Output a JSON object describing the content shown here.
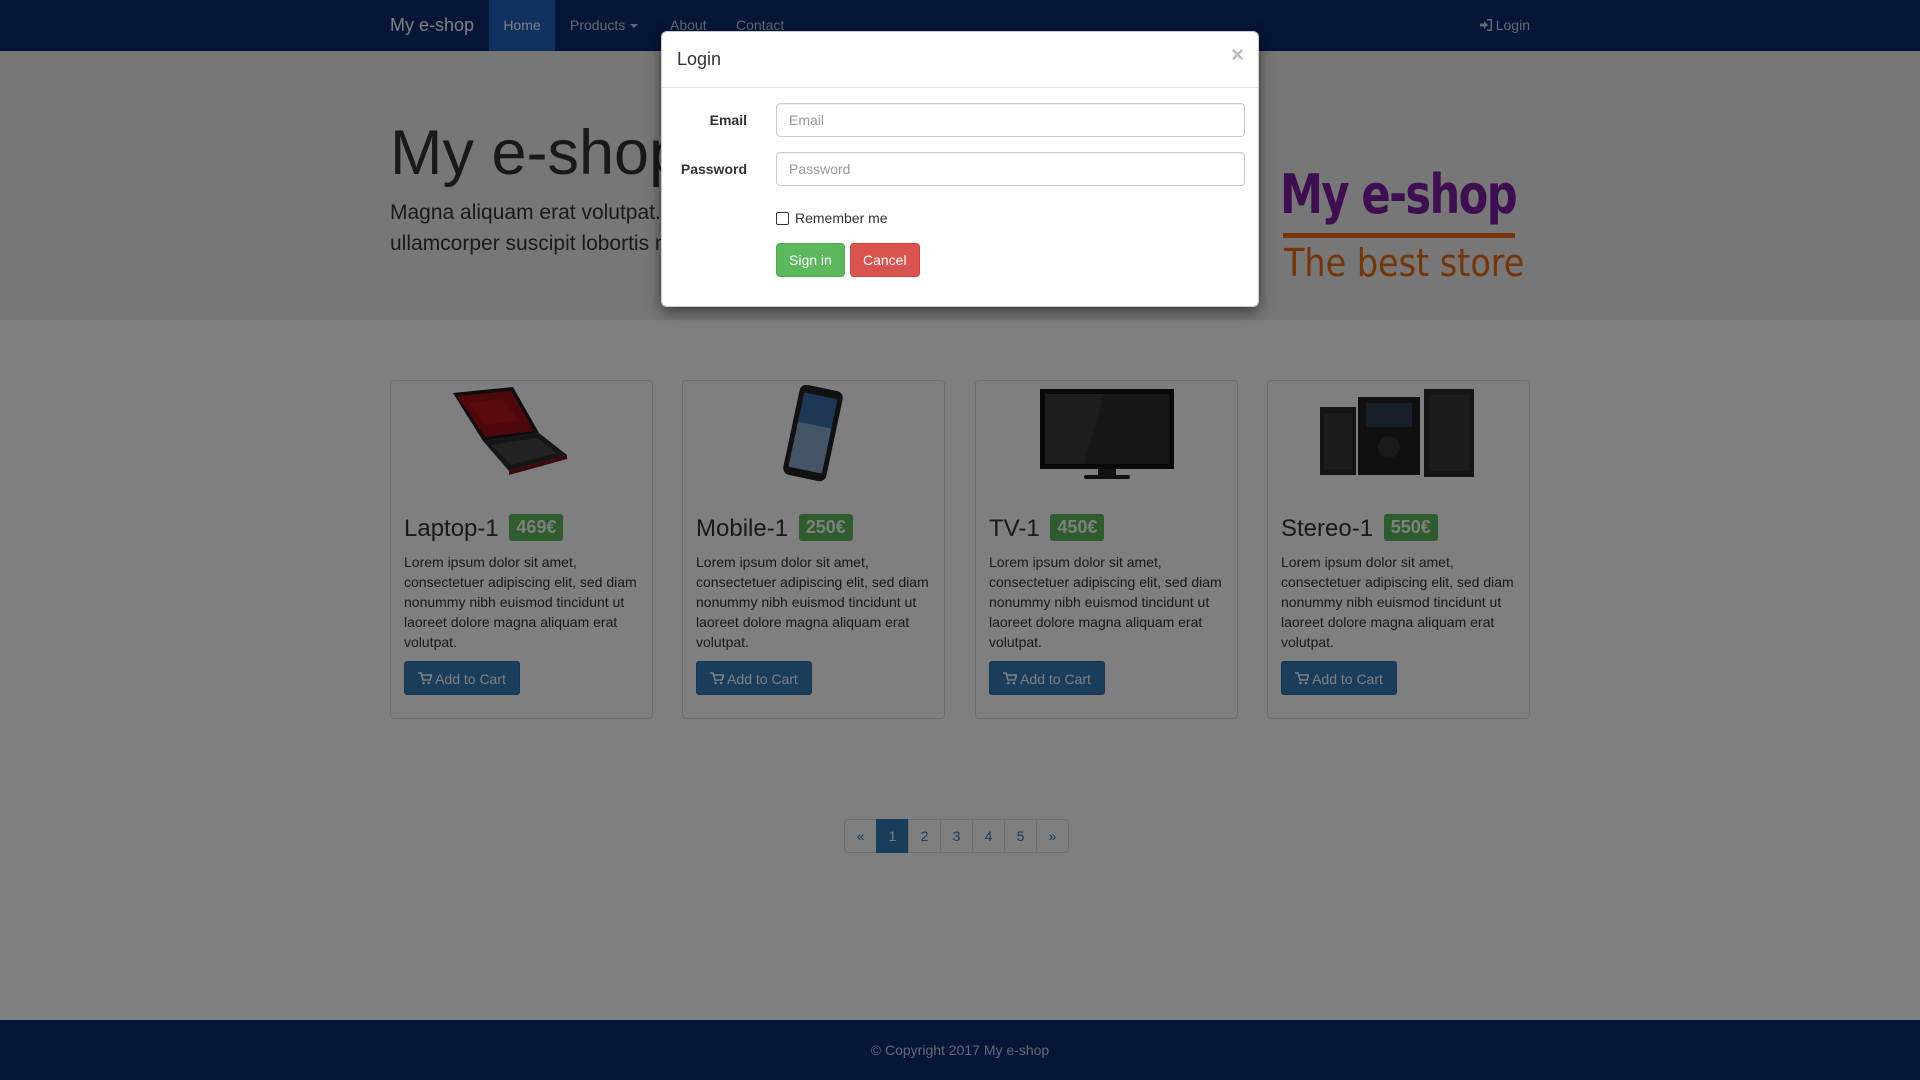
{
  "navbar": {
    "brand": "My e-shop",
    "items": [
      {
        "label": "Home"
      },
      {
        "label": "Products"
      },
      {
        "label": "About"
      },
      {
        "label": "Contact"
      }
    ],
    "login_label": "Login"
  },
  "hero": {
    "title": "My e-shop",
    "text": "Magna aliquam erat volutpat. Ut wisi enim ad minim veniam, quis nostrud exerci tation ullamcorper suscipit lobortis nisl ut aliquip ex ea commodo consequat."
  },
  "logo": {
    "name": "My e-shop",
    "tagline": "The best store"
  },
  "products": [
    {
      "name": "Laptop-1",
      "price": "469€",
      "description": "Lorem ipsum dolor sit amet, consectetuer adipiscing elit, sed diam nonummy nibh euismod tincidunt ut laoreet dolore magna aliquam erat volutpat.",
      "button": "Add to Cart",
      "image_icon": "laptop-image"
    },
    {
      "name": "Mobile-1",
      "price": "250€",
      "description": "Lorem ipsum dolor sit amet, consectetuer adipiscing elit, sed diam nonummy nibh euismod tincidunt ut laoreet dolore magna aliquam erat volutpat.",
      "button": "Add to Cart",
      "image_icon": "mobile-image"
    },
    {
      "name": "TV-1",
      "price": "450€",
      "description": "Lorem ipsum dolor sit amet, consectetuer adipiscing elit, sed diam nonummy nibh euismod tincidunt ut laoreet dolore magna aliquam erat volutpat.",
      "button": "Add to Cart",
      "image_icon": "tv-image"
    },
    {
      "name": "Stereo-1",
      "price": "550€",
      "description": "Lorem ipsum dolor sit amet, consectetuer adipiscing elit, sed diam nonummy nibh euismod tincidunt ut laoreet dolore magna aliquam erat volutpat.",
      "button": "Add to Cart",
      "image_icon": "stereo-image"
    }
  ],
  "pagination": {
    "prev": "«",
    "pages": [
      "1",
      "2",
      "3",
      "4",
      "5"
    ],
    "next": "»",
    "active": "1"
  },
  "footer": {
    "text": "© Copyright 2017 My e-shop"
  },
  "modal": {
    "title": "Login",
    "close": "×",
    "email_label": "Email",
    "email_placeholder": "Email",
    "email_value": "",
    "password_label": "Password",
    "password_placeholder": "Password",
    "password_value": "",
    "remember_label": "Remember me",
    "remember_checked": false,
    "signin_label": "Sign in",
    "cancel_label": "Cancel"
  },
  "colors": {
    "navbar": "#0b2d6e",
    "nav_active": "#1e63c2",
    "primary": "#337ab7",
    "success": "#5cb85c",
    "danger": "#d9534f",
    "logo_purple": "#7a1fa2",
    "logo_orange": "#e86b10"
  }
}
